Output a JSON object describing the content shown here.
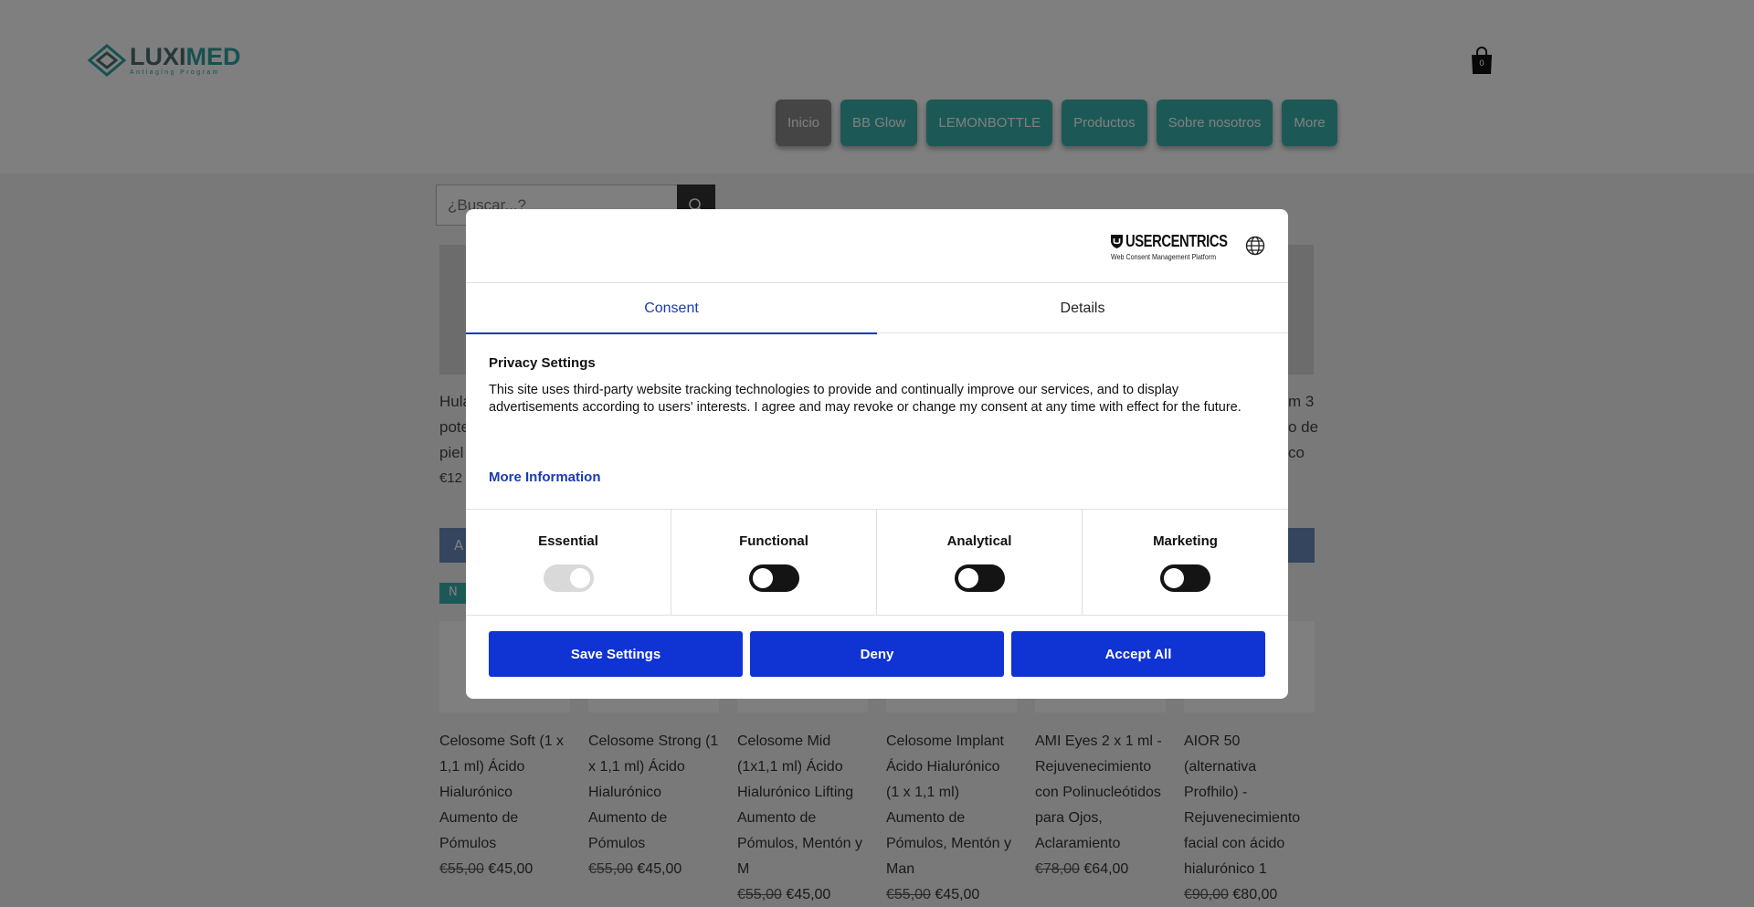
{
  "site": {
    "logo_name_a": "LUXI",
    "logo_name_b": "MED",
    "logo_tagline": "Antiaging Program",
    "cart_count": "0",
    "nav": [
      {
        "label": "Inicio"
      },
      {
        "label": "BB Glow"
      },
      {
        "label": "LEMONBOTTLE"
      },
      {
        "label": "Productos"
      },
      {
        "label": "Sobre nosotros"
      },
      {
        "label": "More"
      }
    ],
    "search_placeholder": "¿Buscar...?"
  },
  "store": {
    "partial_left": [
      "Hula",
      "pote",
      "piel",
      "€12"
    ],
    "partial_right": [
      "m 3",
      "o de",
      "co"
    ],
    "partial_button_left": "A",
    "new_badge": "N",
    "products": [
      {
        "name": "Celosome Soft (1 x 1,1 ml) Ácido Hialurónico Aumento de Pómulos",
        "old_price": "€55,00",
        "price": "€45,00"
      },
      {
        "name": "Celosome Strong (1 x 1,1 ml) Ácido Hialurónico Aumento de Pómulos",
        "old_price": "€55,00",
        "price": "€45,00"
      },
      {
        "name": "Celosome Mid (1x1,1 ml) Ácido Hialurónico Lifting Aumento de Pómulos, Mentón y M",
        "old_price": "€55,00",
        "price": "€45,00"
      },
      {
        "name": "Celosome Implant Ácido Hialurónico (1 x 1,1 ml) Aumento de Pómulos, Mentón y Man",
        "old_price": "€55,00",
        "price": "€45,00"
      },
      {
        "name": "AMI Eyes 2 x 1 ml - Rejuvenecimiento con Polinucleótidos para Ojos, Aclaramiento",
        "old_price": "€78,00",
        "price": "€64,00"
      },
      {
        "name": "AIOR 50 (alternativa Profhilo) - Rejuvenecimiento facial con ácido hialurónico 1",
        "old_price": "€90,00",
        "price": "€80,00"
      }
    ]
  },
  "consent": {
    "brand": "USERCENTRICS",
    "brand_sub": "Web Consent Management Platform",
    "tabs": [
      {
        "label": "Consent"
      },
      {
        "label": "Details"
      }
    ],
    "privacy_title": "Privacy Settings",
    "privacy_text": "This site uses third-party website tracking technologies to provide and continually improve our services, and to display advertisements according to users' interests. I agree and may revoke or change my consent at any time with effect for the future.",
    "more_info": "More Information",
    "categories": [
      {
        "label": "Essential",
        "state": "on-disabled"
      },
      {
        "label": "Functional",
        "state": "off"
      },
      {
        "label": "Analytical",
        "state": "off"
      },
      {
        "label": "Marketing",
        "state": "off"
      }
    ],
    "buttons": {
      "save": "Save Settings",
      "deny": "Deny",
      "accept": "Accept All"
    },
    "accent_color": "#1033d3"
  }
}
